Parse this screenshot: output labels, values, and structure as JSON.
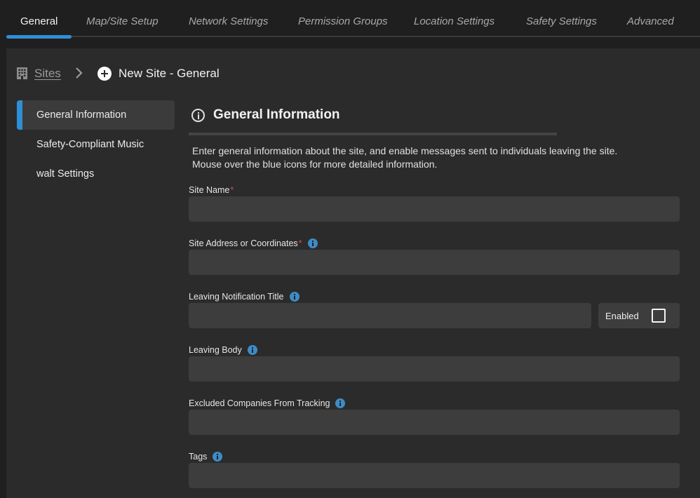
{
  "tabs": [
    {
      "label": "General",
      "active": true
    },
    {
      "label": "Map/Site Setup",
      "active": false
    },
    {
      "label": "Network Settings",
      "active": false
    },
    {
      "label": "Permission Groups",
      "active": false
    },
    {
      "label": "Location Settings",
      "active": false
    },
    {
      "label": "Safety Settings",
      "active": false
    },
    {
      "label": "Advanced",
      "active": false
    }
  ],
  "breadcrumb": {
    "root_label": "Sites",
    "current_label": "New Site - General"
  },
  "sidenav": {
    "items": [
      {
        "label": "General Information",
        "active": true
      },
      {
        "label": "Safety-Compliant Music",
        "active": false
      },
      {
        "label": "walt Settings",
        "active": false
      }
    ]
  },
  "section": {
    "title": "General Information",
    "description_line1": "Enter general information about the site, and enable messages sent to individuals leaving the site.",
    "description_line2": "Mouse over the blue icons for more detailed information."
  },
  "fields": {
    "site_name": {
      "label": "Site Name",
      "required_mark": "*",
      "value": "",
      "placeholder": ""
    },
    "site_address": {
      "label": "Site Address or Coordinates",
      "required_mark": "*",
      "value": "",
      "placeholder": ""
    },
    "leaving_title": {
      "label": "Leaving Notification Title",
      "value": "",
      "placeholder": "",
      "enabled_label": "Enabled",
      "enabled": false
    },
    "leaving_body": {
      "label": "Leaving Body",
      "value": "",
      "placeholder": ""
    },
    "excluded_companies": {
      "label": "Excluded Companies From Tracking",
      "value": "",
      "placeholder": ""
    },
    "tags": {
      "label": "Tags",
      "value": "",
      "placeholder": ""
    }
  },
  "colors": {
    "accent": "#2f8fd6",
    "info_icon": "#3d8cc6",
    "required": "#e04848",
    "background": "#1f1f1f",
    "panel": "#2b2b2b",
    "input_bg": "#3d3d3d"
  },
  "icons": {
    "breadcrumb_root": "building-icon",
    "breadcrumb_separator": "chevron-right-icon",
    "breadcrumb_current": "plus-circle-icon",
    "section": "info-circle-icon",
    "field_help": "info-icon"
  }
}
